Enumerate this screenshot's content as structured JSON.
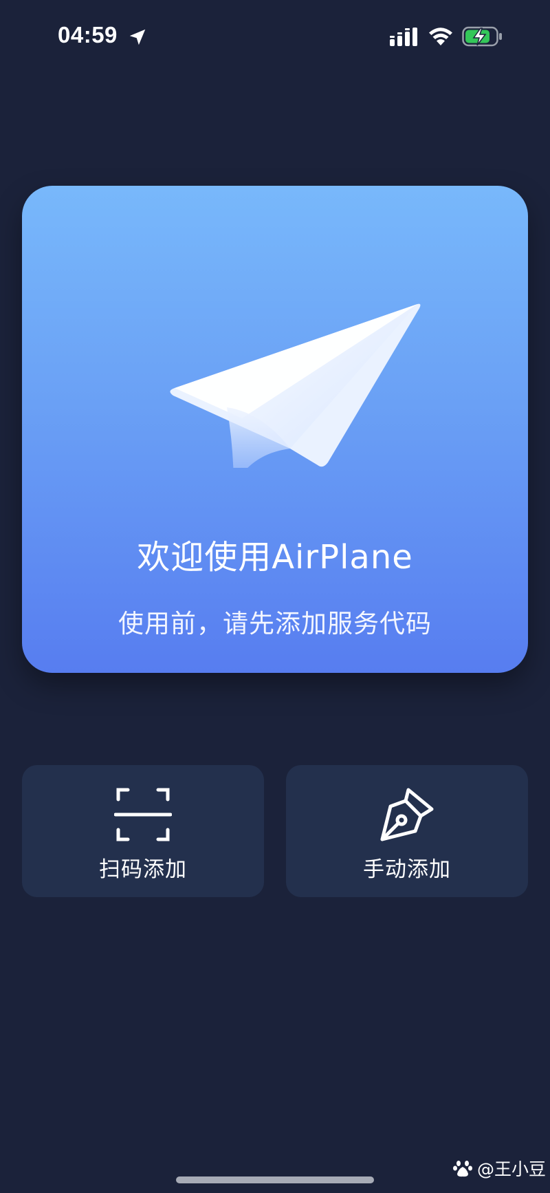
{
  "status_bar": {
    "time": "04:59",
    "icons": [
      "location-arrow-icon",
      "cellular-signal-icon",
      "wifi-icon",
      "battery-charging-icon"
    ],
    "battery_color": "#34c759"
  },
  "welcome_card": {
    "title": "欢迎使用AirPlane",
    "subtitle": "使用前，请先添加服务代码",
    "illustration": "paper-plane-icon",
    "gradient_top": "#78b8fb",
    "gradient_bottom": "#577df0"
  },
  "actions": {
    "scan": {
      "label": "扫码添加",
      "icon": "scan-frame-icon"
    },
    "manual": {
      "label": "手动添加",
      "icon": "pen-nib-icon"
    }
  },
  "watermark": {
    "text": "@王小豆",
    "icon": "baidu-paw-icon"
  },
  "colors": {
    "background": "#1b223a",
    "button_bg": "#23304d"
  }
}
